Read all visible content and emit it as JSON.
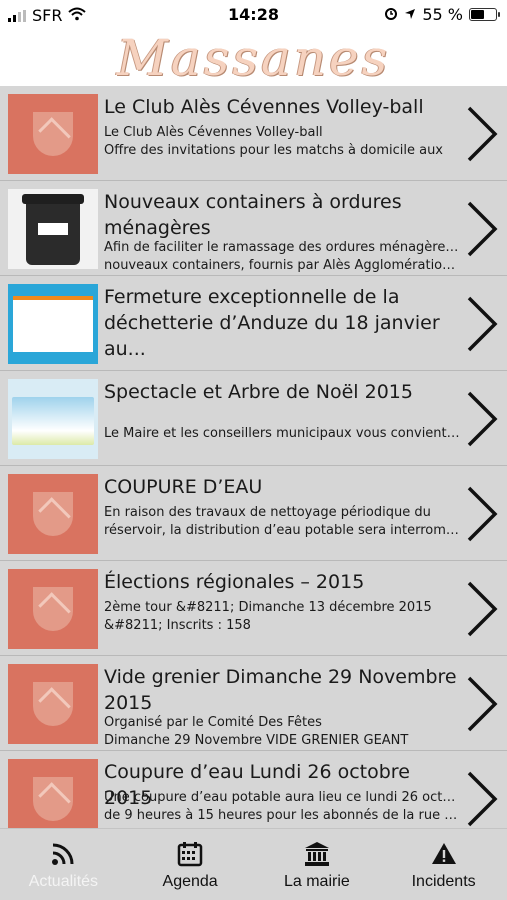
{
  "status_bar": {
    "carrier": "SFR",
    "time": "14:28",
    "battery_percent": "55 %",
    "icons": [
      "signal-icon",
      "wifi-icon",
      "alarm-icon",
      "location-icon",
      "battery-icon"
    ]
  },
  "header": {
    "logo_text": "Massanes"
  },
  "items": [
    {
      "thumb": "crest",
      "title": "Le Club Alès Cévennes Volley-ball",
      "desc1": "Le Club Alès Cévennes Volley-ball",
      "desc2": "Offre des invitations pour les matchs à domicile aux"
    },
    {
      "thumb": "bin",
      "title": "Nouveaux containers à ordures ménagères",
      "desc1": "Afin de faciliter le ramassage des ordures ménagères de",
      "desc2": "nouveaux containers, fournis par Alès Agglomération, s..."
    },
    {
      "thumb": "poster",
      "title": "Fermeture exceptionnelle de la déchetterie d’Anduze du 18 janvier au...",
      "desc1": "",
      "desc2": ""
    },
    {
      "thumb": "xmas",
      "title": "Spectacle et Arbre de Noël 2015",
      "desc1": "",
      "desc2": "Le Maire et les conseillers municipaux vous convient à l..."
    },
    {
      "thumb": "crest",
      "title": "COUPURE D’EAU",
      "desc1": "En raison des travaux de nettoyage périodique du",
      "desc2": "réservoir, la distribution d’eau potable sera interrompu..."
    },
    {
      "thumb": "crest",
      "title": "Élections régionales – 2015",
      "desc1": "2ème tour &#8211; Dimanche 13 décembre 2015",
      "desc2": "&#8211; Inscrits : 158"
    },
    {
      "thumb": "crest",
      "title": "Vide grenier Dimanche 29 Novembre 2015",
      "desc1": "Organisé par le Comité Des Fêtes",
      "desc2": "Dimanche 29 Novembre VIDE GRENIER GEANT"
    },
    {
      "thumb": "crest",
      "title": "Coupure d’eau Lundi 26 octobre 2015",
      "desc1": "Une coupure d’eau potable aura lieu ce lundi 26 octobre",
      "desc2": "de 9 heures à 15 heures pour les abonnés de la rue du..."
    }
  ],
  "tabs": [
    {
      "label": "Actualités",
      "icon": "rss-icon",
      "active": true
    },
    {
      "label": "Agenda",
      "icon": "calendar-icon",
      "active": false
    },
    {
      "label": "La mairie",
      "icon": "town-hall-icon",
      "active": false
    },
    {
      "label": "Incidents",
      "icon": "warning-icon",
      "active": false
    }
  ]
}
